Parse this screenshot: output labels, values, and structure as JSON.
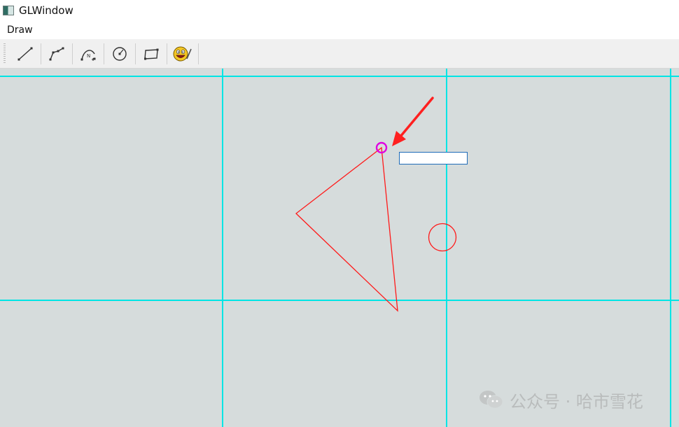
{
  "window": {
    "title": "GLWindow"
  },
  "menu": {
    "items": [
      "Draw"
    ]
  },
  "toolbar": {
    "tools": [
      {
        "name": "line-tool-icon"
      },
      {
        "name": "polyline-tool-icon"
      },
      {
        "name": "curve-tool-icon"
      },
      {
        "name": "circle-tool-icon"
      },
      {
        "name": "rectangle-tool-icon"
      },
      {
        "name": "emoji-draw-tool-icon"
      }
    ]
  },
  "canvas": {
    "background": "#d6dcdc",
    "grid_color": "#00e5e5",
    "shape_color": "#ff1a1a",
    "highlight_color": "#e000e0",
    "annotation_color": "#ff2020"
  },
  "watermark": {
    "text": "公众号 · 哈市雪花"
  }
}
